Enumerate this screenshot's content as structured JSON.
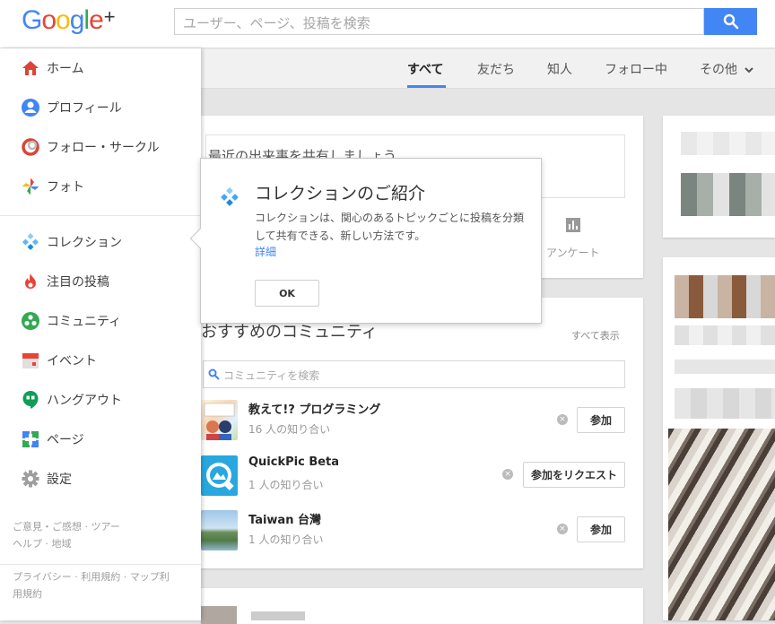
{
  "logo": {
    "letters": [
      "G",
      "o",
      "o",
      "g",
      "l",
      "e",
      "+"
    ],
    "colors": [
      "#4285f4",
      "#ea4335",
      "#fbbc05",
      "#4285f4",
      "#34a853",
      "#ea4335",
      "#333333"
    ]
  },
  "search": {
    "placeholder": "ユーザー、ページ、投稿を検索"
  },
  "tabs": [
    {
      "label": "すべて",
      "active": true
    },
    {
      "label": "友だち"
    },
    {
      "label": "知人"
    },
    {
      "label": "フォロー中"
    },
    {
      "label": "その他"
    }
  ],
  "sidebar": {
    "items": [
      {
        "label": "ホーム",
        "icon": "home-icon"
      },
      {
        "label": "プロフィール",
        "icon": "profile-icon"
      },
      {
        "label": "フォロー・サークル",
        "icon": "circles-icon"
      },
      {
        "label": "フォト",
        "icon": "photos-icon"
      },
      {
        "label": "コレクション",
        "icon": "collections-icon"
      },
      {
        "label": "注目の投稿",
        "icon": "whats-hot-icon"
      },
      {
        "label": "コミュニティ",
        "icon": "communities-icon"
      },
      {
        "label": "イベント",
        "icon": "events-icon"
      },
      {
        "label": "ハングアウト",
        "icon": "hangouts-icon"
      },
      {
        "label": "ページ",
        "icon": "pages-icon"
      },
      {
        "label": "設定",
        "icon": "gear-icon"
      }
    ],
    "footer1": [
      "ご意見・ご感想 · ツアー",
      "ヘルプ · 地域"
    ],
    "footer2": [
      "プライバシー · 利用規約 · マップ利",
      "用規約"
    ]
  },
  "share": {
    "placeholder": "最近の出来事を共有しましょう",
    "poll_label": "アンケート"
  },
  "communities": {
    "title": "おすすめのコミュニティ",
    "see_all": "すべて表示",
    "search_placeholder": "コミュニティを検索",
    "items": [
      {
        "name": "教えて!? プログラミング",
        "count": "16 人の知り合い",
        "action": "参加"
      },
      {
        "name": "QuickPic Beta",
        "count": "1 人の知り合い",
        "action": "参加をリクエスト"
      },
      {
        "name": "Taiwan 台灣",
        "count": "1 人の知り合い",
        "action": "参加"
      }
    ]
  },
  "popup": {
    "title": "コレクションのご紹介",
    "body": "コレクションは、関心のあるトピックごとに投稿を分類して共有できる、新しい方法です。",
    "link": "詳細",
    "ok": "OK"
  },
  "colors": {
    "accent": "#4285f4",
    "background": "#e5e5e5"
  }
}
